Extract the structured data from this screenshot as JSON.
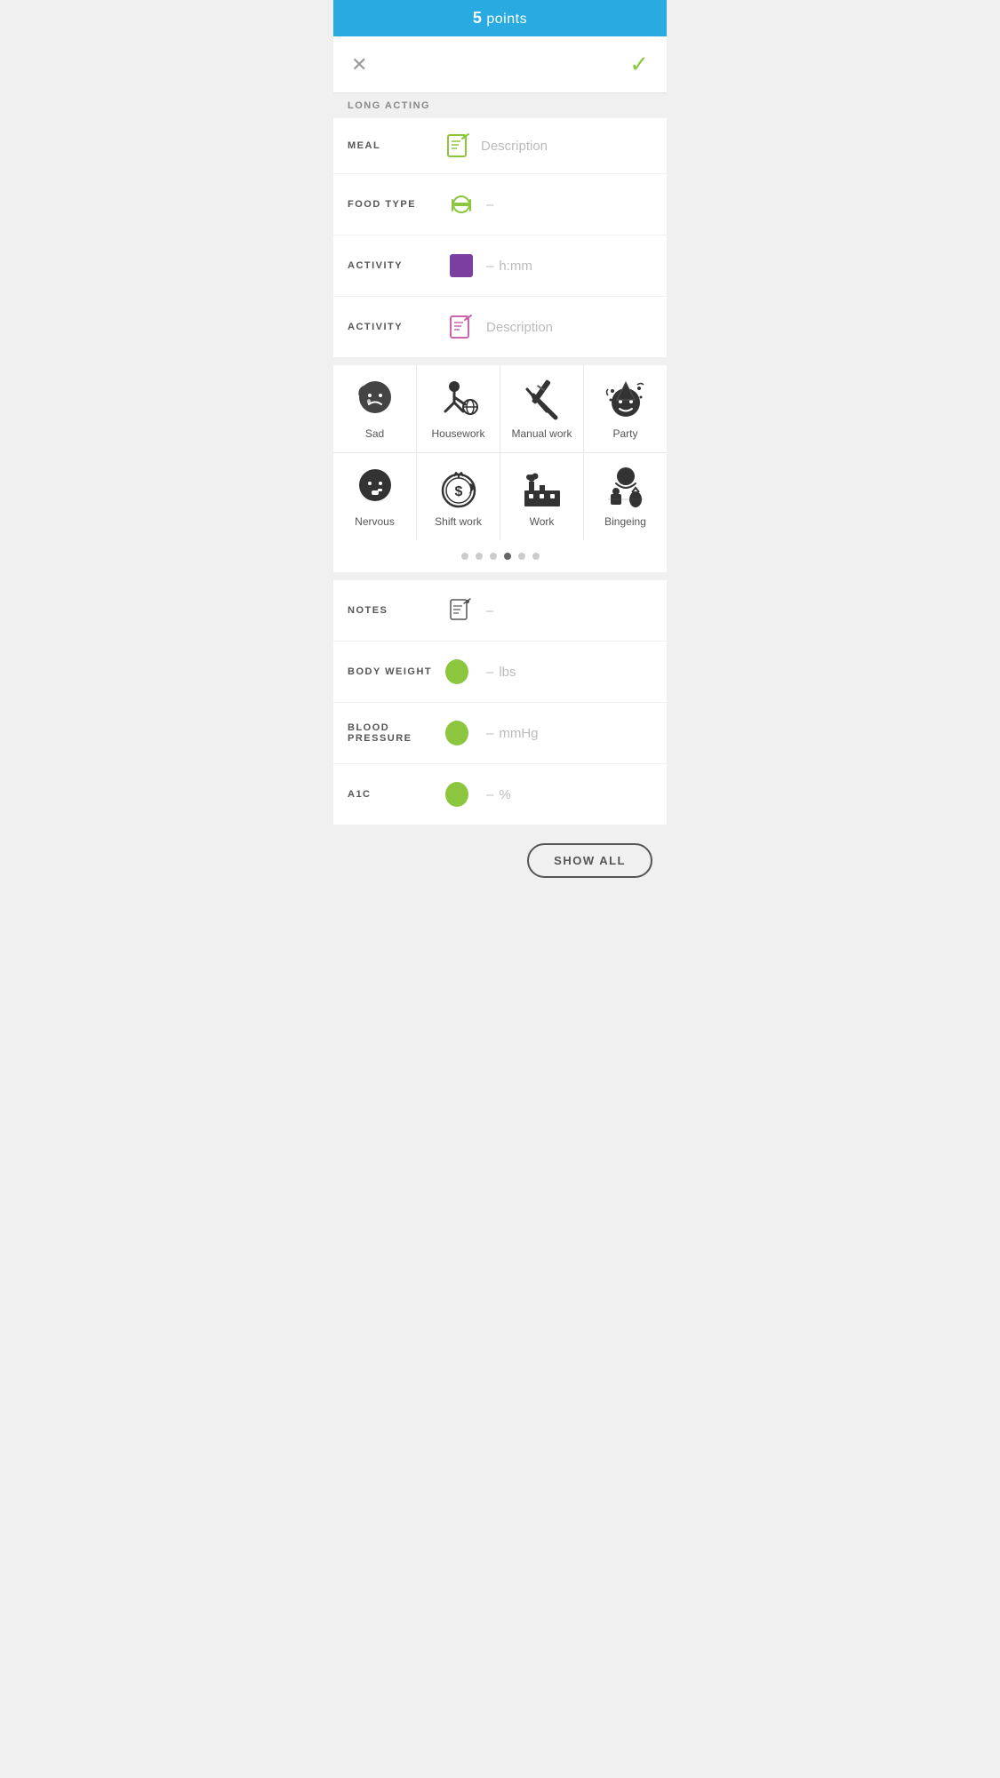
{
  "topBar": {
    "points": "5",
    "label": " points"
  },
  "nav": {
    "closeLabel": "✕",
    "checkLabel": "✓"
  },
  "sectionLabel": "LONG ACTING",
  "fields": {
    "meal": {
      "label": "MEAL",
      "placeholder": "Description"
    },
    "foodType": {
      "label": "FOOD TYPE",
      "dash": "–"
    },
    "activity1": {
      "label": "ACTIVITY",
      "dash": "–",
      "placeholder": "h:mm"
    },
    "activity2": {
      "label": "ACTIVITY",
      "placeholder": "Description"
    }
  },
  "iconGrid": {
    "items": [
      {
        "id": "sad",
        "label": "Sad"
      },
      {
        "id": "housework",
        "label": "Housework"
      },
      {
        "id": "manual-work",
        "label": "Manual work"
      },
      {
        "id": "party",
        "label": "Party"
      },
      {
        "id": "nervous",
        "label": "Nervous"
      },
      {
        "id": "shift-work",
        "label": "Shift work"
      },
      {
        "id": "work",
        "label": "Work"
      },
      {
        "id": "bingeing",
        "label": "Bingeing"
      }
    ]
  },
  "pagination": {
    "dots": [
      false,
      false,
      false,
      true,
      false,
      false
    ]
  },
  "notes": {
    "label": "NOTES",
    "dash": "–"
  },
  "bodyWeight": {
    "label": "BODY WEIGHT",
    "dash": "–",
    "unit": "lbs"
  },
  "bloodPressure": {
    "label": "BLOOD PRESSURE",
    "dash": "–",
    "unit": "mmHg"
  },
  "a1c": {
    "label": "A1C",
    "dash": "–",
    "unit": "%"
  },
  "showAll": {
    "label": "SHOW ALL"
  }
}
